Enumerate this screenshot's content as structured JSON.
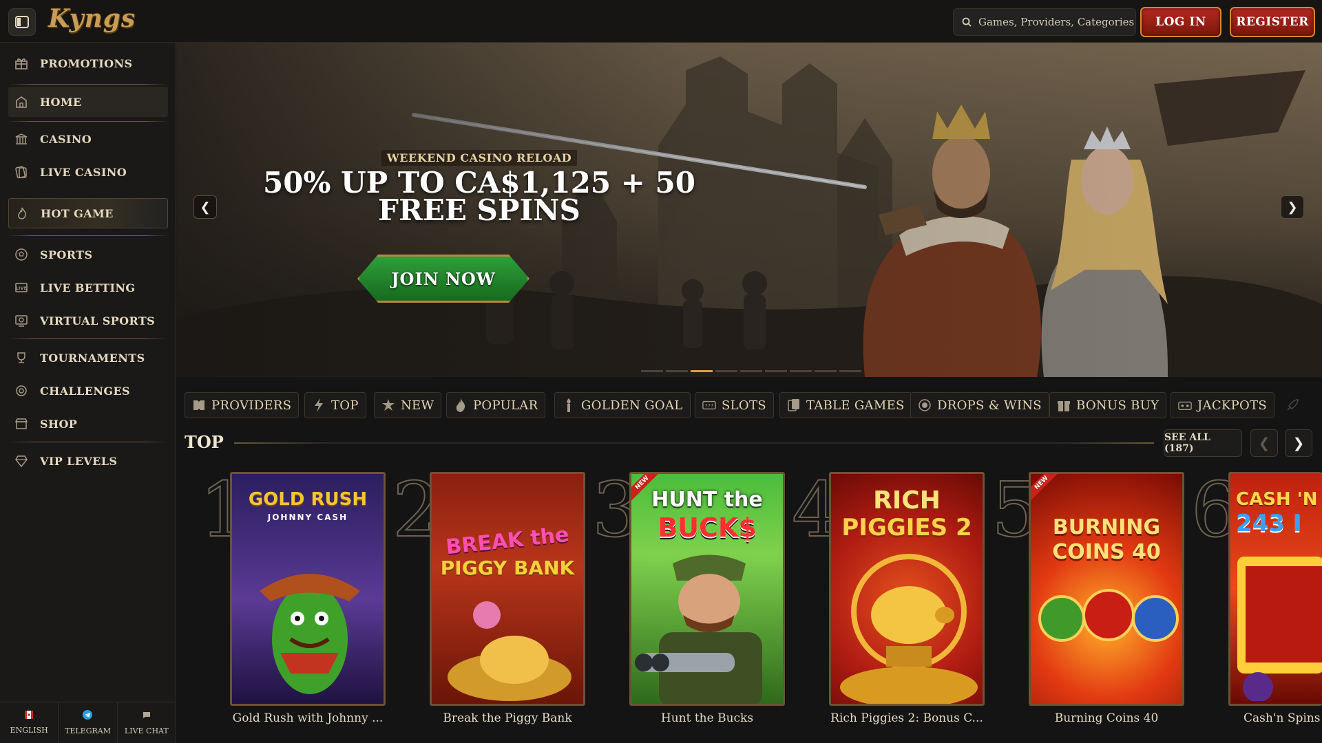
{
  "header": {
    "logo": "Kyngs",
    "search_placeholder": "Games, Providers, Categories",
    "login_label": "LOG IN",
    "register_label": "REGISTER"
  },
  "sidebar": {
    "items": [
      {
        "label": "PROMOTIONS",
        "icon": "gift-icon"
      },
      {
        "label": "HOME",
        "icon": "home-icon"
      },
      {
        "label": "CASINO",
        "icon": "casino-icon"
      },
      {
        "label": "LIVE CASINO",
        "icon": "live-casino-icon"
      },
      {
        "label": "HOT GAME",
        "icon": "flame-icon"
      },
      {
        "label": "SPORTS",
        "icon": "soccer-ball-icon"
      },
      {
        "label": "LIVE BETTING",
        "icon": "live-betting-icon"
      },
      {
        "label": "VIRTUAL SPORTS",
        "icon": "virtual-sports-icon"
      },
      {
        "label": "TOURNAMENTS",
        "icon": "trophy-icon"
      },
      {
        "label": "CHALLENGES",
        "icon": "challenge-icon"
      },
      {
        "label": "SHOP",
        "icon": "shop-icon"
      },
      {
        "label": "VIP LEVELS",
        "icon": "diamond-icon"
      }
    ],
    "footer": [
      {
        "label": "ENGLISH",
        "icon": "flag-icon"
      },
      {
        "label": "TELEGRAM",
        "icon": "telegram-icon"
      },
      {
        "label": "LIVE CHAT",
        "icon": "chat-icon"
      }
    ]
  },
  "hero": {
    "subtitle": "WEEKEND CASINO RELOAD",
    "title_line1": "50% UP TO CA$1,125 + 50",
    "title_line2": "FREE SPINS",
    "cta": "JOIN NOW",
    "slide_count": 9,
    "active_slide": 2
  },
  "tabs": [
    {
      "label": "PROVIDERS",
      "icon": "book-icon"
    },
    {
      "label": "TOP",
      "icon": "lightning-icon"
    },
    {
      "label": "NEW",
      "icon": "new-icon"
    },
    {
      "label": "POPULAR",
      "icon": "flame-icon"
    },
    {
      "label": "GOLDEN GOAL",
      "icon": "torch-icon"
    },
    {
      "label": "SLOTS",
      "icon": "slots-icon"
    },
    {
      "label": "TABLE GAMES",
      "icon": "cards-icon"
    },
    {
      "label": "DROPS & WINS",
      "icon": "drops-icon"
    },
    {
      "label": "BONUS BUY",
      "icon": "gift-icon"
    },
    {
      "label": "JACKPOTS",
      "icon": "jackpot-icon"
    }
  ],
  "top_section": {
    "title": "TOP",
    "see_all": "SEE ALL (187)",
    "games": [
      {
        "rank": "1",
        "title": "Gold Rush with Johnny ...",
        "logo_line1": "GOLD RUSH",
        "logo_line2": "JOHNNY CASH",
        "badge": ""
      },
      {
        "rank": "2",
        "title": "Break the Piggy Bank",
        "logo_line1": "BREAK the",
        "logo_line2": "PIGGY BANK",
        "badge": ""
      },
      {
        "rank": "3",
        "title": "Hunt the Bucks",
        "logo_line1": "HUNT the",
        "logo_line2": "BUCK$",
        "badge": "NEW"
      },
      {
        "rank": "4",
        "title": "Rich Piggies 2: Bonus C...",
        "logo_line1": "RICH",
        "logo_line2": "PIGGIES 2",
        "badge": ""
      },
      {
        "rank": "5",
        "title": "Burning Coins 40",
        "logo_line1": "BURNING",
        "logo_line2": "COINS 40",
        "badge": "NEW"
      },
      {
        "rank": "6",
        "title": "Cash'n Spins",
        "logo_line1": "CASH 'N",
        "logo_line2": "243 I",
        "badge": ""
      }
    ]
  }
}
